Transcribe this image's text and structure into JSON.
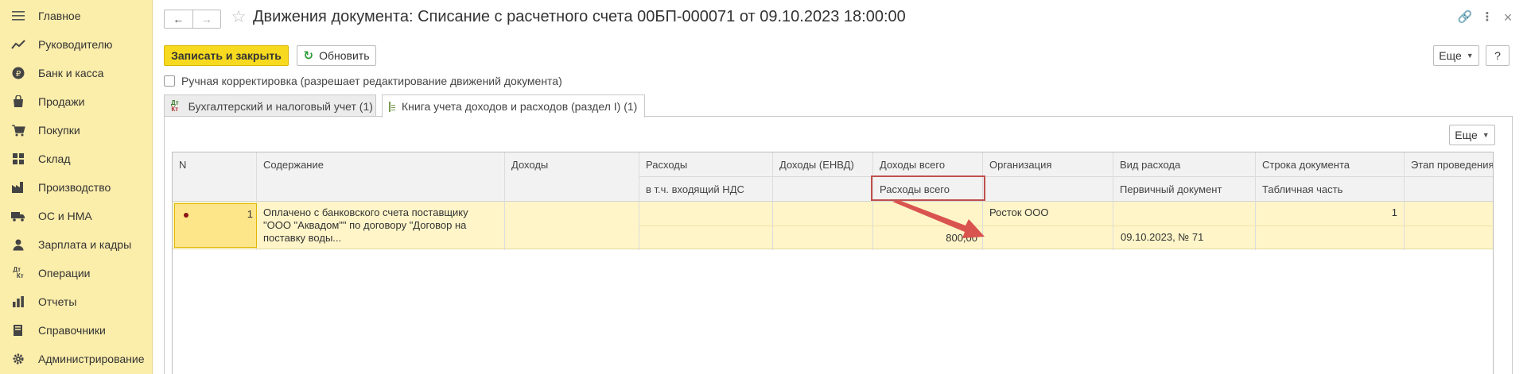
{
  "sidebar": {
    "items": [
      {
        "label": "Главное",
        "icon": "menu-icon"
      },
      {
        "label": "Руководителю",
        "icon": "trend-icon"
      },
      {
        "label": "Банк и касса",
        "icon": "ruble-coin-icon"
      },
      {
        "label": "Продажи",
        "icon": "shopping-bag-icon"
      },
      {
        "label": "Покупки",
        "icon": "cart-icon"
      },
      {
        "label": "Склад",
        "icon": "warehouse-icon"
      },
      {
        "label": "Производство",
        "icon": "factory-icon"
      },
      {
        "label": "ОС и НМА",
        "icon": "truck-icon"
      },
      {
        "label": "Зарплата и кадры",
        "icon": "person-icon"
      },
      {
        "label": "Операции",
        "icon": "dt-kt-icon"
      },
      {
        "label": "Отчеты",
        "icon": "chart-bars-icon"
      },
      {
        "label": "Справочники",
        "icon": "book-icon"
      },
      {
        "label": "Администрирование",
        "icon": "gear-icon"
      }
    ]
  },
  "header": {
    "title": "Движения документа: Списание с расчетного счета 00БП-000071 от 09.10.2023 18:00:00"
  },
  "toolbar": {
    "save_close_label": "Записать и закрыть",
    "refresh_label": "Обновить",
    "more_label": "Еще",
    "help_label": "?"
  },
  "manual_edit": {
    "label": "Ручная корректировка (разрешает редактирование движений документа)",
    "checked": false
  },
  "tabs": [
    {
      "label": "Бухгалтерский и налоговый учет (1)",
      "icon": "dt-kt-icon",
      "active": false
    },
    {
      "label": "Книга учета доходов и расходов (раздел I) (1)",
      "icon": "document-icon",
      "active": true
    }
  ],
  "grid": {
    "more_label": "Еще",
    "columns_row1": [
      "N",
      "Содержание",
      "Доходы",
      "Расходы",
      "Доходы (ЕНВД)",
      "Доходы всего",
      "Организация",
      "Вид расхода",
      "Строка документа",
      "Этап проведения"
    ],
    "columns_row2": [
      "в т.ч. входящий НДС",
      "Расходы всего",
      "Первичный документ",
      "Табличная часть"
    ],
    "row": {
      "n": "1",
      "content_lines": [
        "Оплачено с банковского счета поставщику",
        "\"ООО \"Аквадом\"\" по договору \"Договор на",
        "поставку воды..."
      ],
      "expenses_total": "800,00",
      "organization": "Росток ООО",
      "primary_doc": "09.10.2023, № 71",
      "doc_line": "1"
    }
  },
  "colors": {
    "sidebar_bg": "#fbedaa",
    "primary_button": "#f7da1f",
    "selected_row": "#fff5c8",
    "highlight_frame": "#c0504d",
    "arrow": "#d9534f"
  }
}
